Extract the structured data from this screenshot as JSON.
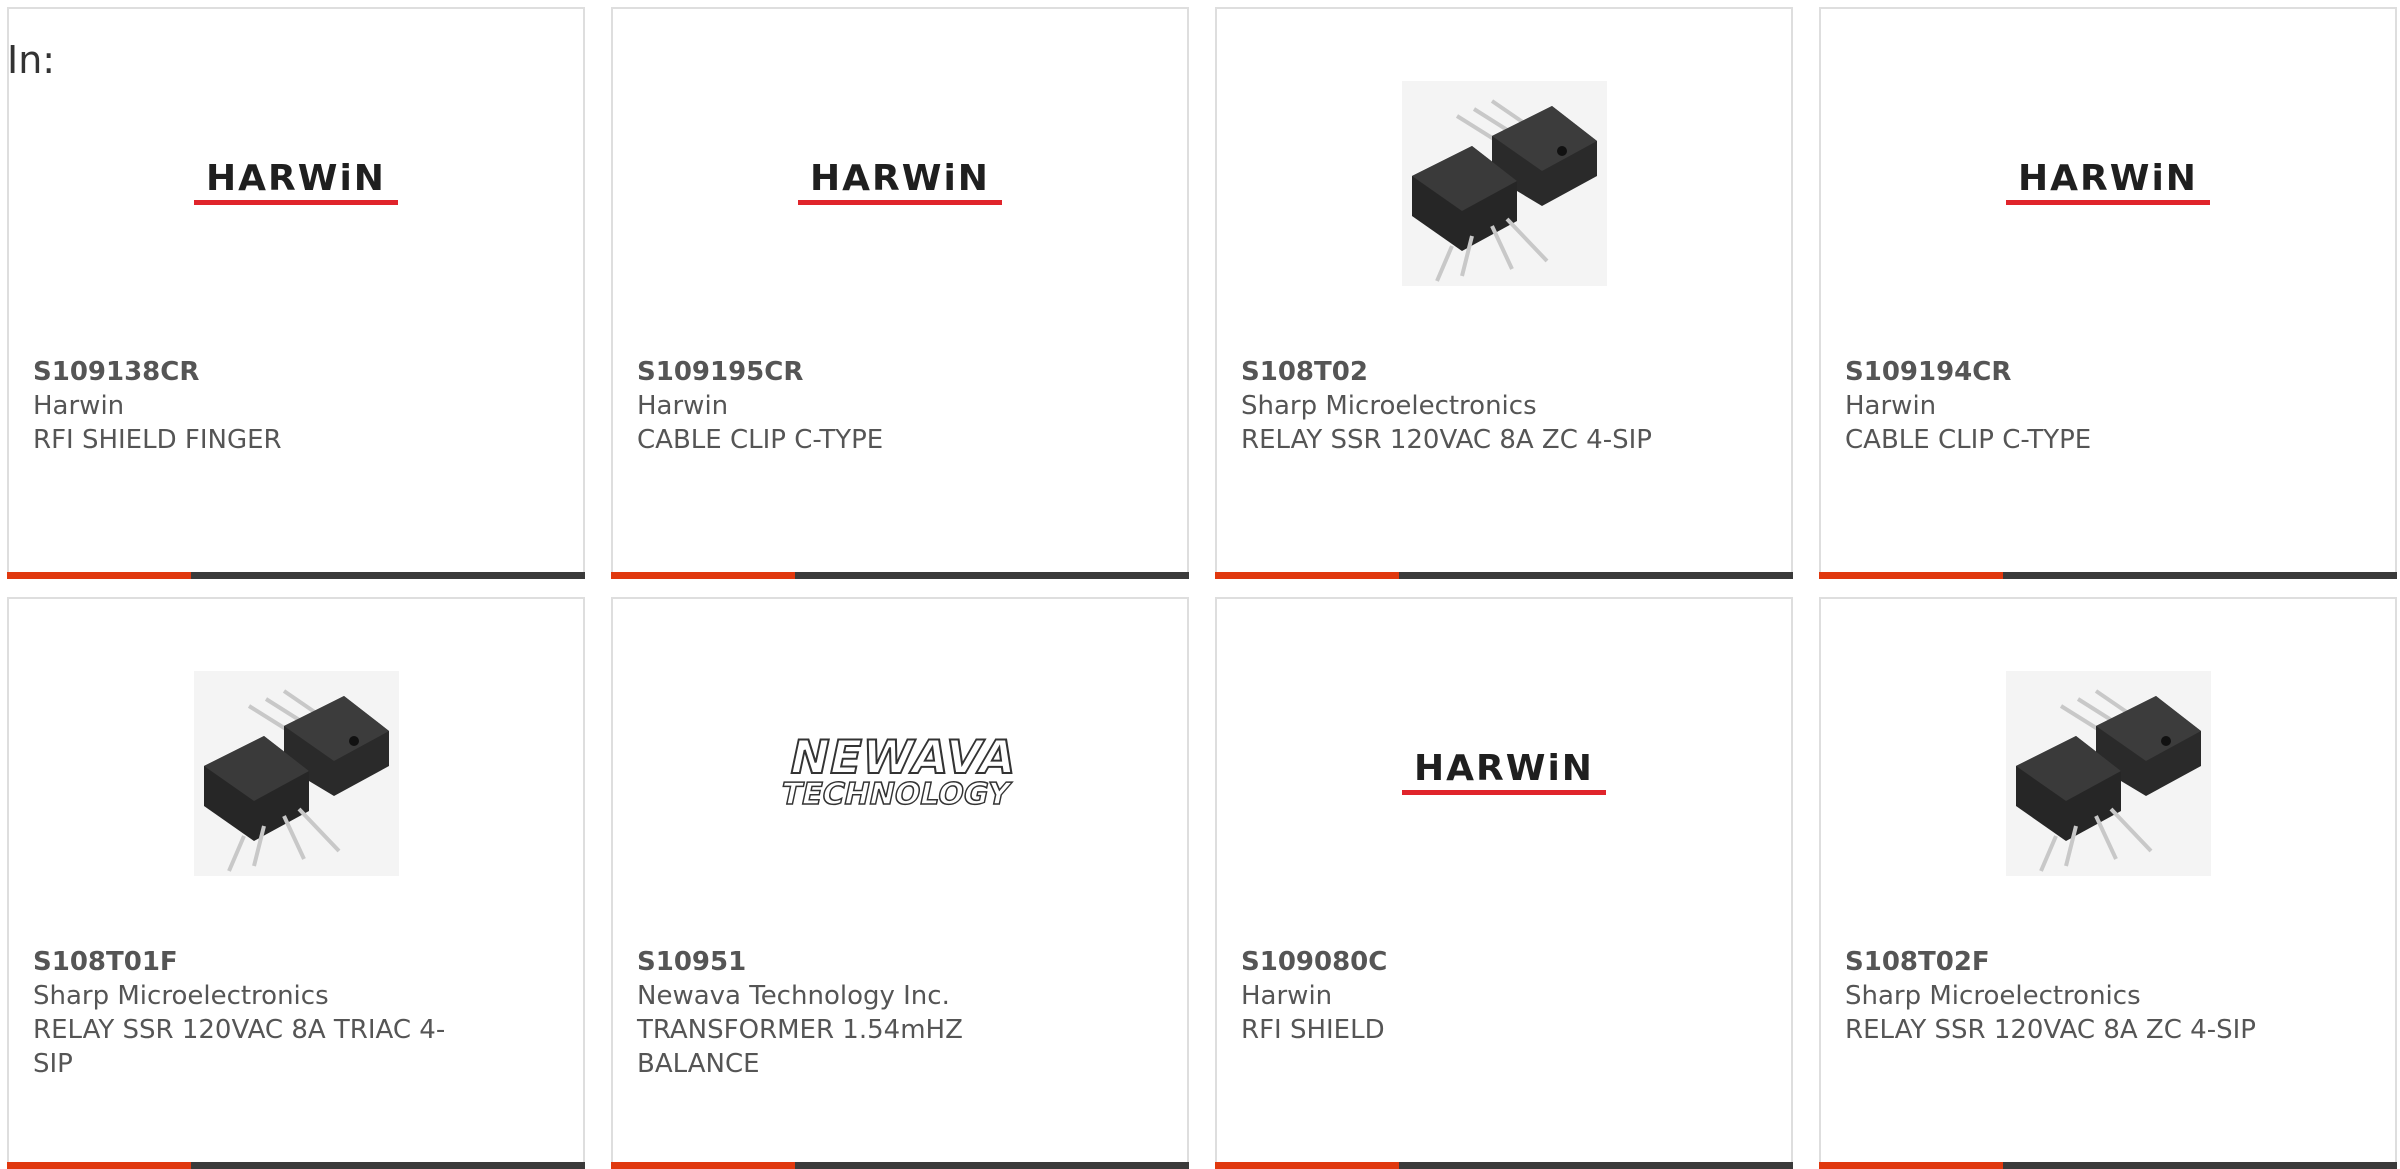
{
  "heading": "In:",
  "colors": {
    "accent": "#e0380e",
    "bar": "#3a3a3a",
    "text": "#555555",
    "harwin_red": "#e0242b"
  },
  "products": [
    {
      "part": "S109138CR",
      "manufacturer": "Harwin",
      "description": "RFI SHIELD FINGER",
      "image": "harwin-logo",
      "logo_text": "HARWiN"
    },
    {
      "part": "S109195CR",
      "manufacturer": "Harwin",
      "description": "CABLE CLIP C-TYPE",
      "image": "harwin-logo",
      "logo_text": "HARWiN"
    },
    {
      "part": "S108T02",
      "manufacturer": "Sharp Microelectronics",
      "description": "RELAY SSR 120VAC 8A ZC 4-SIP",
      "image": "relay-photo"
    },
    {
      "part": "S109194CR",
      "manufacturer": "Harwin",
      "description": "CABLE CLIP C-TYPE",
      "image": "harwin-logo",
      "logo_text": "HARWiN"
    },
    {
      "part": "S108T01F",
      "manufacturer": "Sharp Microelectronics",
      "description": "RELAY SSR 120VAC 8A TRIAC 4-SIP",
      "image": "relay-photo"
    },
    {
      "part": "S10951",
      "manufacturer": "Newava Technology Inc.",
      "description": "TRANSFORMER 1.54mHZ BALANCE",
      "image": "newava-logo",
      "logo_line1": "NEWAVA",
      "logo_line2": "TECHNOLOGY"
    },
    {
      "part": "S109080C",
      "manufacturer": "Harwin",
      "description": "RFI SHIELD",
      "image": "harwin-logo",
      "logo_text": "HARWiN"
    },
    {
      "part": "S108T02F",
      "manufacturer": "Sharp Microelectronics",
      "description": "RELAY SSR 120VAC 8A ZC 4-SIP",
      "image": "relay-photo"
    }
  ]
}
